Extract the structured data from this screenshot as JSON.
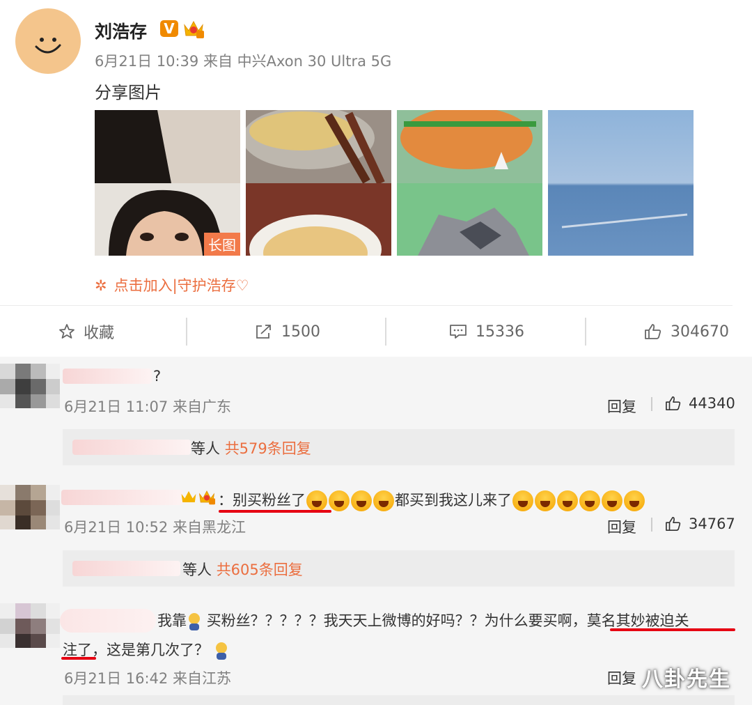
{
  "post": {
    "author": "刘浩存",
    "verified_badge": "V",
    "meta": "6月21日 10:39 来自 中兴Axon 30 Ultra 5G",
    "text": "分享图片",
    "long_image_badge": "长图",
    "join_text": "点击加入|守护浩存♡"
  },
  "actions": {
    "favorite": "收藏",
    "repost": "1500",
    "comment": "15336",
    "like": "304670"
  },
  "comments": [
    {
      "text": "?",
      "meta": "6月21日 11:07 来自广东",
      "reply_label": "回复",
      "likes": "44340",
      "thread_others": "等人",
      "thread_count": "共579条回复"
    },
    {
      "text_prefix": "：",
      "text_highlight": "别买粉丝了",
      "text_middle": "都买到我这儿来了",
      "meta": "6月21日 10:52 来自黑龙江",
      "reply_label": "回复",
      "likes": "34767",
      "thread_others": "等人",
      "thread_count": "共605条回复"
    },
    {
      "text_a": "我靠",
      "text_b": "买粉丝？？？？？我天天上微博的好吗？？为什么要买啊，",
      "text_highlight_1": "莫名其妙被迫关",
      "text_highlight_2": "注了",
      "text_c": "，这是第几次了？",
      "meta": "6月21日 16:42 来自江苏",
      "reply_label": "回复"
    }
  ],
  "watermark": "八卦先生",
  "colors": {
    "accent_orange": "#eb6e3f",
    "underline_red": "#e60012",
    "verified_orange": "#f08a00"
  }
}
